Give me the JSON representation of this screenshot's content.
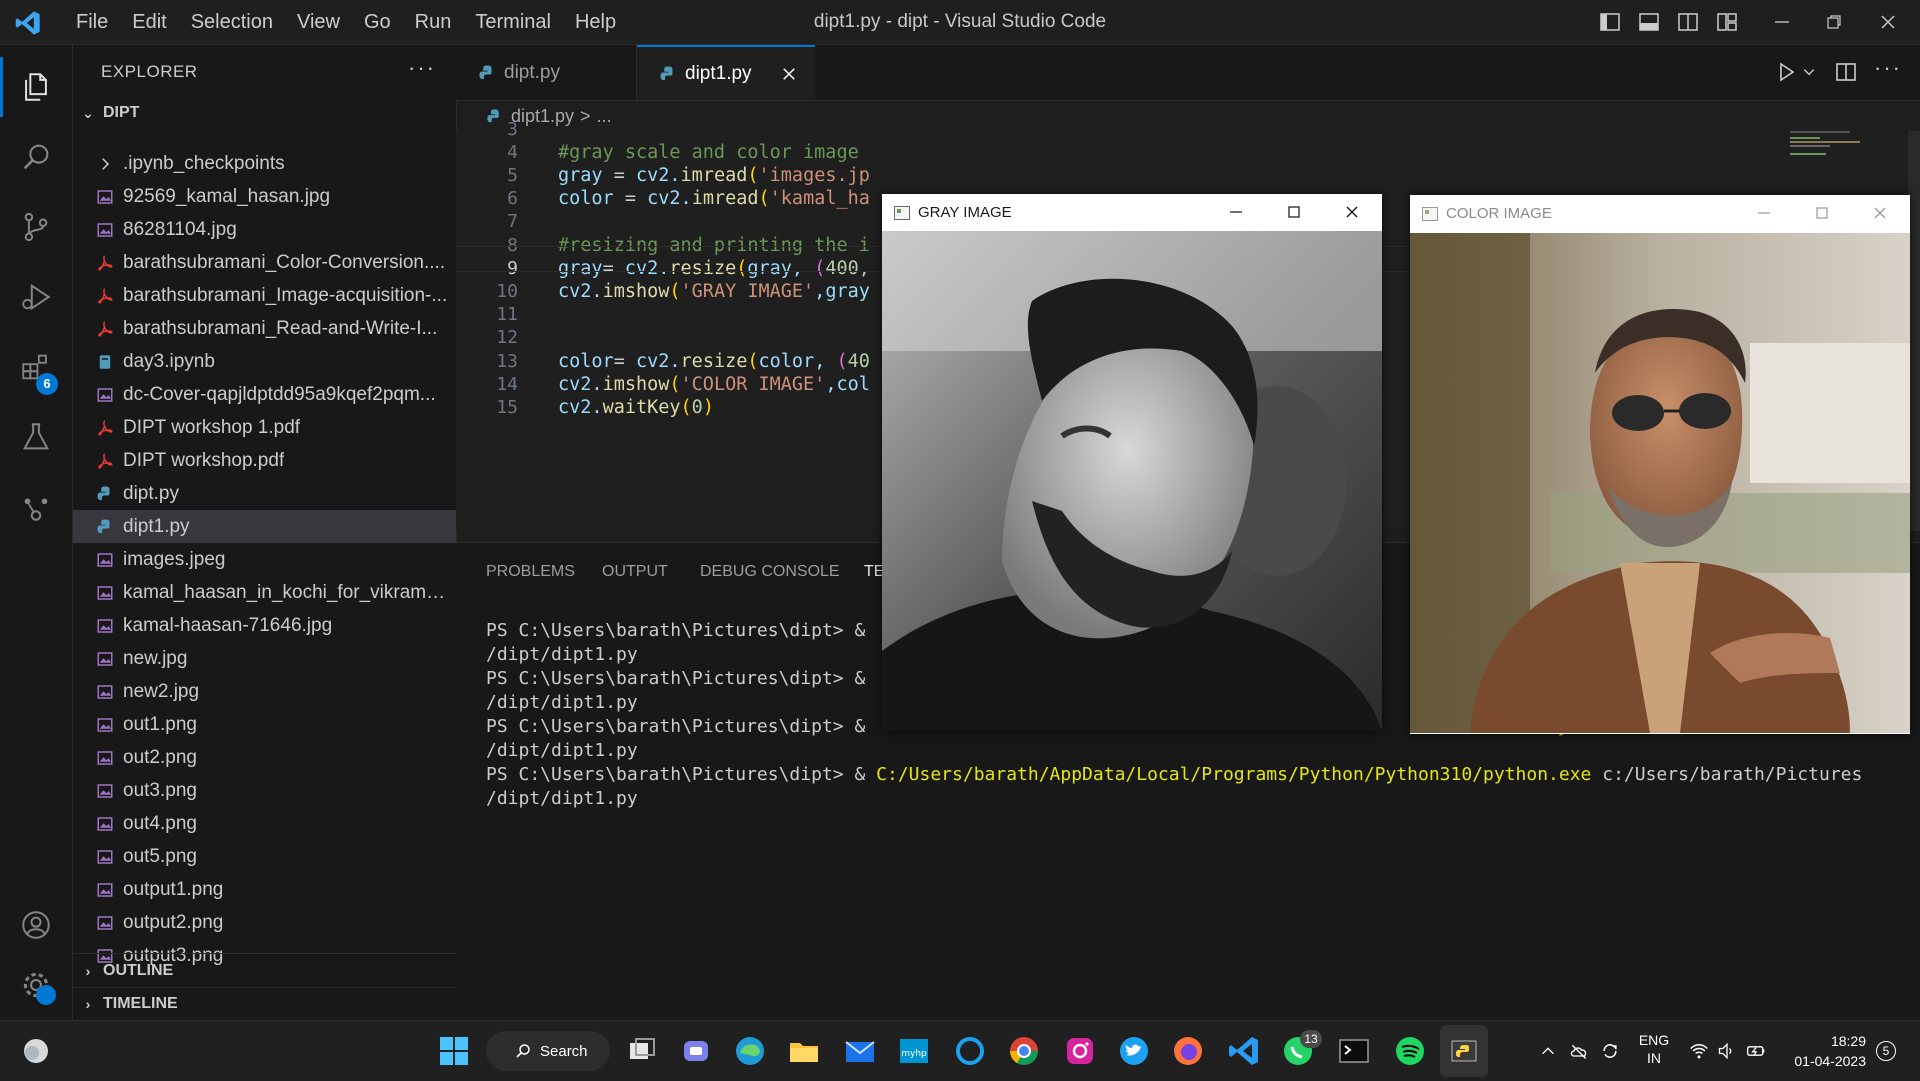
{
  "window": {
    "title": "dipt1.py - dipt - Visual Studio Code",
    "menu": [
      "File",
      "Edit",
      "Selection",
      "View",
      "Go",
      "Run",
      "Terminal",
      "Help"
    ]
  },
  "activity_bar": {
    "extensions_badge": "6"
  },
  "sidebar": {
    "header": "EXPLORER",
    "more": "···",
    "folder": "DIPT",
    "items": [
      {
        "label": ".ipynb_checkpoints",
        "type": "folder"
      },
      {
        "label": "92569_kamal_hasan.jpg",
        "type": "image"
      },
      {
        "label": "86281104.jpg",
        "type": "image"
      },
      {
        "label": "barathsubramani_Color-Conversion....",
        "type": "pdf"
      },
      {
        "label": "barathsubramani_Image-acquisition-...",
        "type": "pdf"
      },
      {
        "label": "barathsubramani_Read-and-Write-I...",
        "type": "pdf"
      },
      {
        "label": "day3.ipynb",
        "type": "notebook"
      },
      {
        "label": "dc-Cover-qapjldptdd95a9kqef2pqm...",
        "type": "image"
      },
      {
        "label": "DIPT workshop 1.pdf",
        "type": "pdf"
      },
      {
        "label": "DIPT workshop.pdf",
        "type": "pdf"
      },
      {
        "label": "dipt.py",
        "type": "python"
      },
      {
        "label": "dipt1.py",
        "type": "python",
        "selected": true
      },
      {
        "label": "images.jpeg",
        "type": "image"
      },
      {
        "label": "kamal_haasan_in_kochi_for_vikram_p...",
        "type": "image"
      },
      {
        "label": "kamal-haasan-71646.jpg",
        "type": "image"
      },
      {
        "label": "new.jpg",
        "type": "image"
      },
      {
        "label": "new2.jpg",
        "type": "image"
      },
      {
        "label": "out1.png",
        "type": "image"
      },
      {
        "label": "out2.png",
        "type": "image"
      },
      {
        "label": "out3.png",
        "type": "image"
      },
      {
        "label": "out4.png",
        "type": "image"
      },
      {
        "label": "out5.png",
        "type": "image"
      },
      {
        "label": "output1.png",
        "type": "image"
      },
      {
        "label": "output2.png",
        "type": "image"
      },
      {
        "label": "output3.png",
        "type": "image"
      }
    ],
    "outline": "OUTLINE",
    "timeline": "TIMELINE"
  },
  "tabs": [
    {
      "label": "dipt.py",
      "active": false
    },
    {
      "label": "dipt1.py",
      "active": true
    }
  ],
  "breadcrumb": {
    "file": "dipt1.py",
    "sep": ">",
    "rest": "..."
  },
  "editor": {
    "current_line": "9",
    "lines": [
      {
        "n": "3"
      },
      {
        "n": "4",
        "comment": "#gray scale and color image"
      },
      {
        "n": "5",
        "var": "gray",
        "op": " = ",
        "call": "cv2.",
        "fn": "imread",
        "open": "(",
        "str": "'images.jp"
      },
      {
        "n": "6",
        "var": "color",
        "op": " = ",
        "call": "cv2.",
        "fn": "imread",
        "open": "(",
        "str": "'kamal_ha"
      },
      {
        "n": "7"
      },
      {
        "n": "8",
        "comment": "#resizing and printing the i"
      },
      {
        "n": "9",
        "var": "gray",
        "op": "= ",
        "call": "cv2.",
        "fn": "resize",
        "open": "(",
        "arg": "gray, ",
        "open2": "(",
        "num": "400,"
      },
      {
        "n": "10",
        "call": "cv2.",
        "fn": "imshow",
        "open": "(",
        "str": "'GRAY IMAGE'",
        "arg": ",gray"
      },
      {
        "n": "11"
      },
      {
        "n": "12"
      },
      {
        "n": "13",
        "var": "color",
        "op": "= ",
        "call": "cv2.",
        "fn": "resize",
        "open": "(",
        "arg": "color, ",
        "open2": "(",
        "num": "40"
      },
      {
        "n": "14",
        "call": "cv2.",
        "fn": "imshow",
        "open": "(",
        "str": "'COLOR IMAGE'",
        "arg": ",col"
      },
      {
        "n": "15",
        "call": "cv2.",
        "fn": "waitKey",
        "open": "(",
        "num": "0",
        "close": ")"
      }
    ]
  },
  "panel": {
    "tabs": [
      "PROBLEMS",
      "OUTPUT",
      "DEBUG CONSOLE",
      "TE"
    ],
    "terminal": [
      {
        "prompt": "PS C:\\Users\\barath\\Pictures\\dipt> ",
        "amp": "&",
        "tail": "/Py"
      },
      {
        "text": "/dipt/dipt1.py"
      },
      {
        "prompt": "PS C:\\Users\\barath\\Pictures\\dipt> ",
        "amp": "&",
        "tail": "/Py"
      },
      {
        "text": "/dipt/dipt1.py"
      },
      {
        "prompt": "PS C:\\Users\\barath\\Pictures\\dipt> ",
        "amp": "&",
        "tail": "/Py"
      },
      {
        "text": "/dipt/dipt1.py"
      },
      {
        "prompt": "PS C:\\Users\\barath\\Pictures\\dipt> ",
        "amp": "& ",
        "exe": "C:/Users/barath/AppData/Local/Programs/Python/Python310/python.exe",
        "rest": " c:/Users/barath/Pictures"
      },
      {
        "text": "/dipt/dipt1.py"
      }
    ]
  },
  "windows": {
    "gray": {
      "title": "GRAY IMAGE"
    },
    "color": {
      "title": "COLOR IMAGE"
    }
  },
  "taskbar": {
    "search_label": "Search",
    "whatsapp_badge": "13",
    "lang_top": "ENG",
    "lang_bottom": "IN",
    "time": "18:29",
    "date": "01-04-2023",
    "notification_count": "5"
  },
  "colors": {
    "accent": "#0078d4",
    "editor_bg": "#1f1f1f",
    "sidebar_bg": "#181818",
    "comment": "#6a9955",
    "string": "#ce9178",
    "function": "#dcdcaa",
    "variable": "#9cdcfe"
  }
}
